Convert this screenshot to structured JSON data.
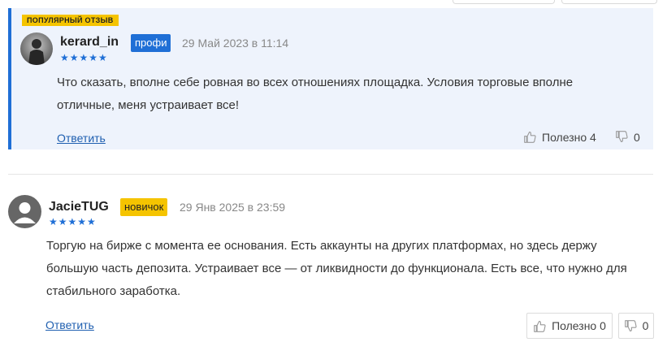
{
  "reviews": [
    {
      "badge": "ПОПУЛЯРНЫЙ ОТЗЫВ",
      "username": "kerard_in",
      "tag": "профи",
      "date": "29 Май 2023 в 11:14",
      "rating": 5,
      "stars": "★★★★★",
      "text": "Что сказать, вполне себе ровная во всех отношениях площадка. Условия торговые вполне отличные, меня устраивает все!",
      "reply_label": "Ответить",
      "useful_label": "Полезно 4",
      "dislike_count": "0"
    },
    {
      "username": "JacieTUG",
      "tag": "новичок",
      "date": "29 Янв 2025 в 23:59",
      "rating": 5,
      "stars": "★★★★★",
      "text": "Торгую на бирже с момента ее основания. Есть аккаунты на других платформах, но здесь держу большую часть депозита. Устраивает все — от ликвидности до функционала. Есть все, что нужно для стабильного заработка.",
      "reply_label": "Ответить",
      "useful_label": "Полезно 0",
      "dislike_count": "0"
    }
  ],
  "colors": {
    "accent": "#1f6fd6",
    "badge": "#f5c400",
    "highlight_bg": "#eef3fc"
  },
  "icons": [
    "thumbs-up-icon",
    "thumbs-down-icon",
    "user-avatar-icon"
  ]
}
